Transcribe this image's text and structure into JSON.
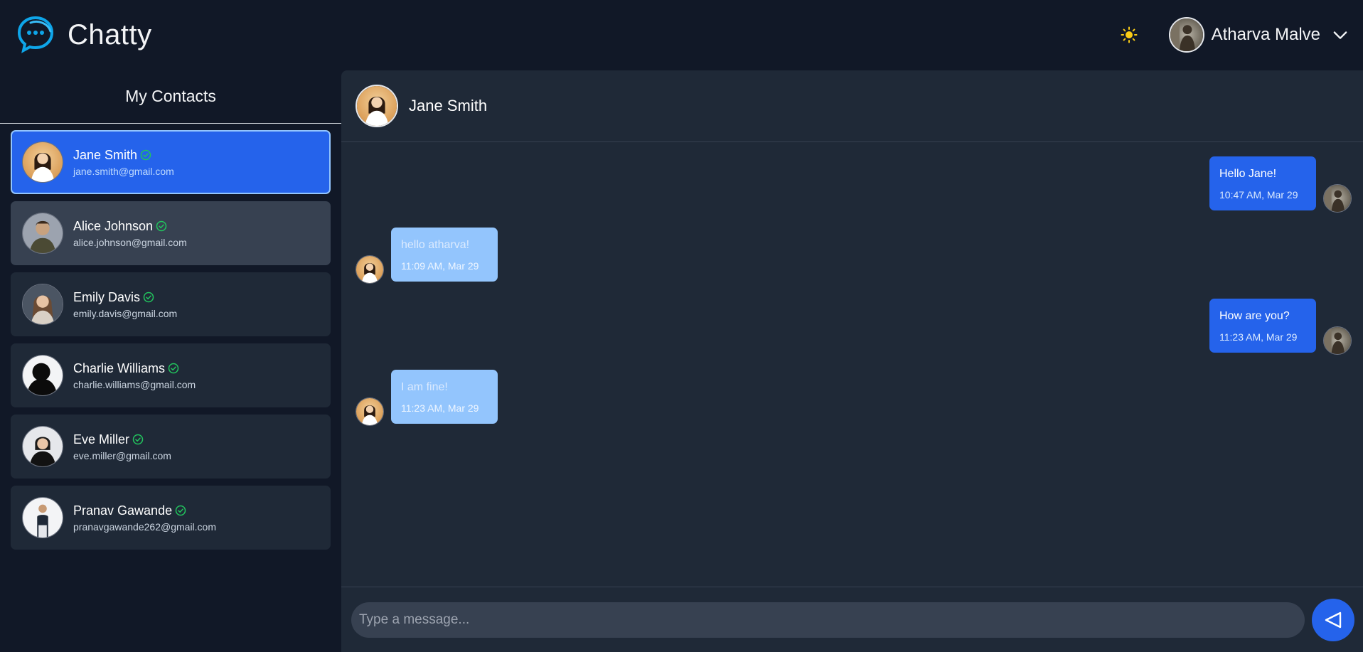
{
  "app": {
    "name": "Chatty"
  },
  "header": {
    "theme_icon": "sun-icon",
    "user_name": "Atharva Malve",
    "dropdown_icon": "chevron-down-icon"
  },
  "sidebar": {
    "title": "My Contacts",
    "contacts": [
      {
        "name": "Jane Smith",
        "email": "jane.smith@gmail.com",
        "status": "online",
        "active": true
      },
      {
        "name": "Alice Johnson",
        "email": "alice.johnson@gmail.com",
        "status": "online"
      },
      {
        "name": "Emily Davis",
        "email": "emily.davis@gmail.com",
        "status": "online"
      },
      {
        "name": "Charlie Williams",
        "email": "charlie.williams@gmail.com",
        "status": "online"
      },
      {
        "name": "Eve Miller",
        "email": "eve.miller@gmail.com",
        "status": "online"
      },
      {
        "name": "Pranav Gawande",
        "email": "pranavgawande262@gmail.com",
        "status": "online"
      }
    ]
  },
  "chat": {
    "contact_name": "Jane Smith",
    "messages": [
      {
        "direction": "out",
        "text": "Hello Jane!",
        "time": "10:47 AM, Mar 29"
      },
      {
        "direction": "in",
        "text": "hello atharva!",
        "time": "11:09 AM, Mar 29"
      },
      {
        "direction": "out",
        "text": "How are you?",
        "time": "11:23 AM, Mar 29"
      },
      {
        "direction": "in",
        "text": "I am fine!",
        "time": "11:23 AM, Mar 29"
      }
    ],
    "composer": {
      "placeholder": "Type a message...",
      "send_icon": "send-icon"
    }
  },
  "colors": {
    "background": "#111827",
    "panel": "#1f2937",
    "accent": "#2563eb",
    "incoming_bubble": "#93c5fd",
    "online": "#22c55e"
  }
}
